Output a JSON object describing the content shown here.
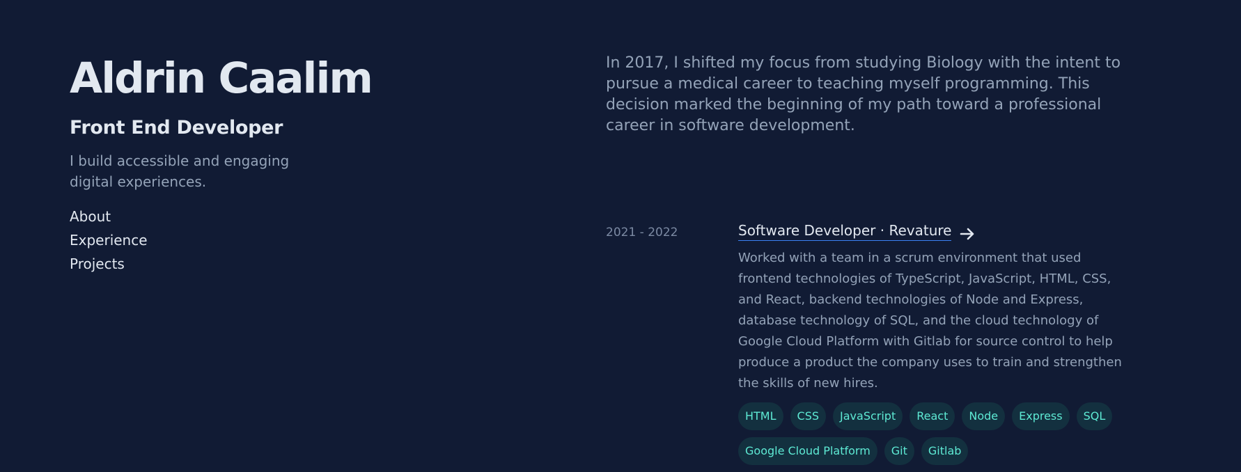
{
  "header": {
    "name": "Aldrin Caalim",
    "role": "Front End Developer",
    "tagline": "I build accessible and engaging digital experiences."
  },
  "nav": {
    "items": [
      {
        "label": "About"
      },
      {
        "label": "Experience"
      },
      {
        "label": "Projects"
      }
    ]
  },
  "about": {
    "text": "In 2017, I shifted my focus from studying Biology with the intent to pursue a medical career to teaching myself programming. This decision marked the beginning of my path toward a professional career in software development."
  },
  "experience": [
    {
      "dates": "2021 - 2022",
      "title": "Software Developer · Revature",
      "description": "Worked with a team in a scrum environment that used frontend technologies of TypeScript, JavaScript, HTML, CSS, and React, backend technologies of Node and Express, database technology of SQL, and the cloud technology of Google Cloud Platform with Gitlab for source control to help produce a product the company uses to train and strengthen the skills of new hires.",
      "tags": [
        "HTML",
        "CSS",
        "JavaScript",
        "React",
        "Node",
        "Express",
        "SQL",
        "Google Cloud Platform",
        "Git",
        "Gitlab"
      ]
    }
  ],
  "colors": {
    "background": "#111b34",
    "heading": "#e2e8f0",
    "muted": "#94a3b8",
    "tag_text": "#5eead4",
    "tag_bg": "#13303f",
    "link_underline": "#3b82f6"
  },
  "icons": {
    "title_link": "arrow-right-icon"
  }
}
